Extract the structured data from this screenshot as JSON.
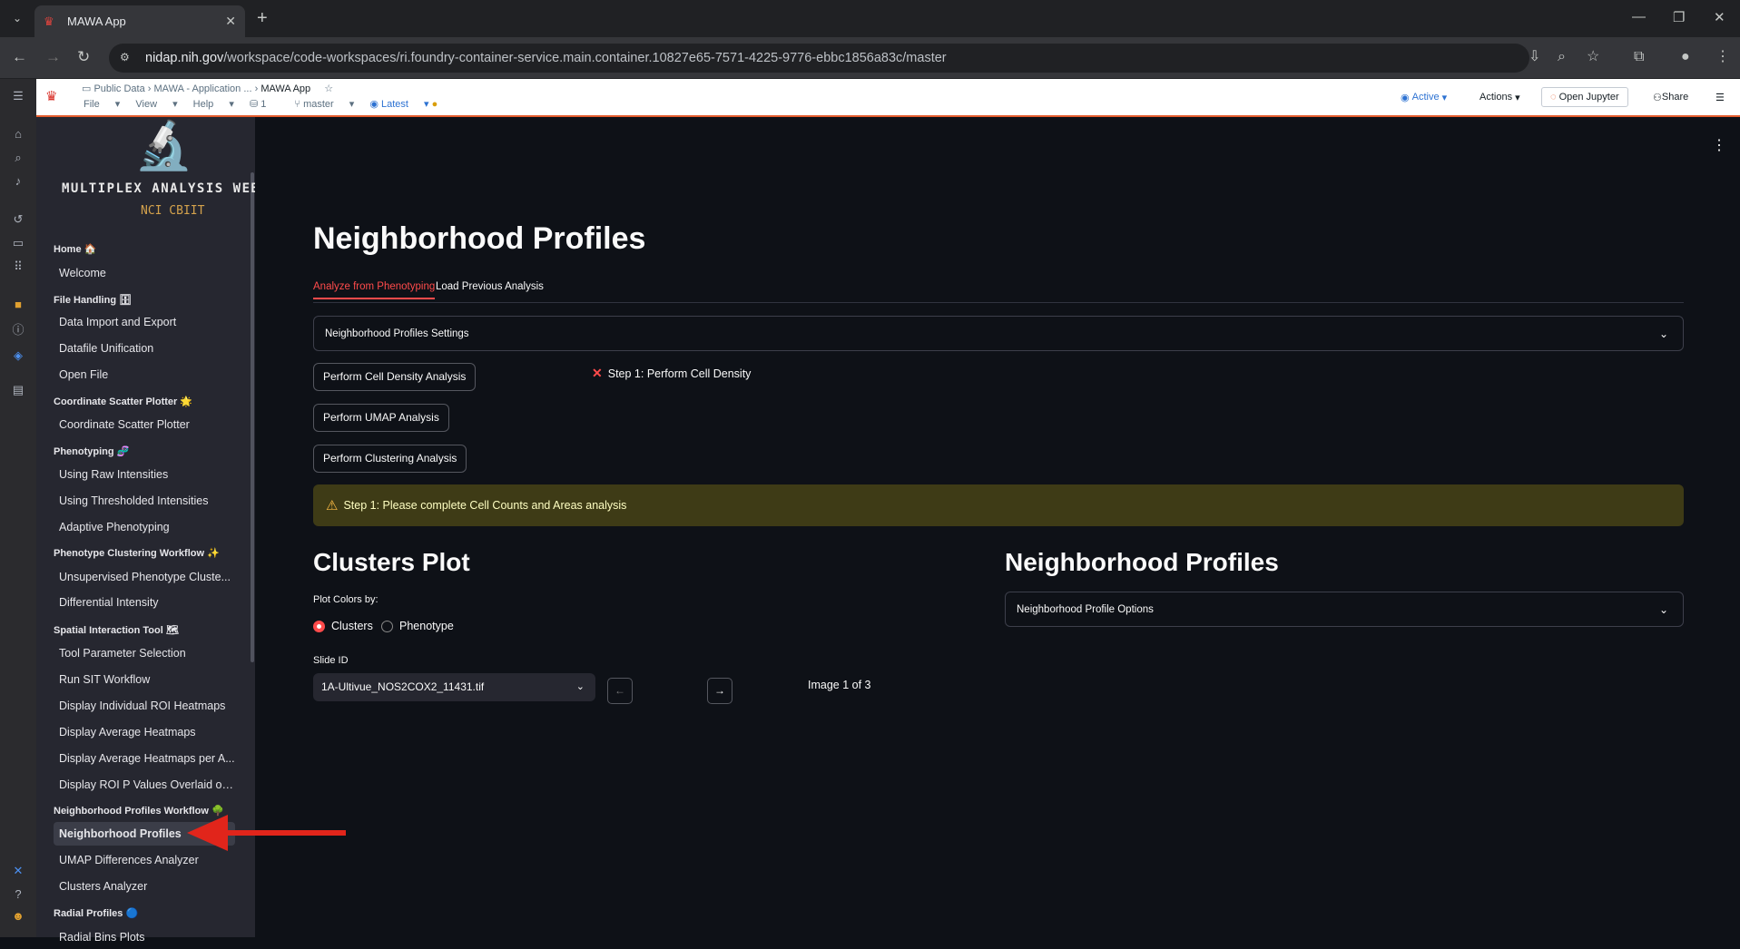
{
  "browser": {
    "tab_title": "MAWA App",
    "url_domain": "nidap.nih.gov",
    "url_path": "/workspace/code-workspaces/ri.foundry-container-service.main.container.10827e65-7571-4225-9776-ebbc1856a83c/master"
  },
  "appbar": {
    "breadcrumb": [
      "Public Data",
      "MAWA - Application ...",
      "MAWA App"
    ],
    "menus": [
      "File",
      "View",
      "Help"
    ],
    "count": "1",
    "branch": "master",
    "version": "Latest",
    "status": "Active",
    "actions_label": "Actions",
    "open_jupyter_label": "Open Jupyter",
    "share_label": "Share"
  },
  "sidebar": {
    "logo_title": "MULTIPLEX ANALYSIS WEB AP",
    "logo_subtitle": "NCI CBIIT",
    "groups": [
      {
        "label": "Home 🏠",
        "items": [
          "Welcome"
        ]
      },
      {
        "label": "File Handling 🗄",
        "items": [
          "Data Import and Export",
          "Datafile Unification",
          "Open File"
        ]
      },
      {
        "label": "Coordinate Scatter Plotter 🌟",
        "items": [
          "Coordinate Scatter Plotter"
        ]
      },
      {
        "label": "Phenotyping 🧬",
        "items": [
          "Using Raw Intensities",
          "Using Thresholded Intensities",
          "Adaptive Phenotyping"
        ]
      },
      {
        "label": "Phenotype Clustering Workflow ✨",
        "items": [
          "Unsupervised Phenotype Cluste...",
          "Differential Intensity"
        ]
      },
      {
        "label": "Spatial Interaction Tool 🗺",
        "items": [
          "Tool Parameter Selection",
          "Run SIT Workflow",
          "Display Individual ROI Heatmaps",
          "Display Average Heatmaps",
          "Display Average Heatmaps per A...",
          "Display ROI P Values Overlaid on..."
        ]
      },
      {
        "label": "Neighborhood Profiles Workflow 🌳",
        "items": [
          "Neighborhood Profiles",
          "UMAP Differences Analyzer",
          "Clusters Analyzer"
        ]
      },
      {
        "label": "Radial Profiles 🔵",
        "items": [
          "Radial Bins Plots"
        ]
      }
    ],
    "selected": "Neighborhood Profiles"
  },
  "main": {
    "title": "Neighborhood Profiles",
    "tabs": [
      "Analyze from Phenotyping",
      "Load Previous Analysis"
    ],
    "settings_expander": "Neighborhood Profiles Settings",
    "buttons": [
      "Perform Cell Density Analysis",
      "Perform UMAP Analysis",
      "Perform Clustering Analysis"
    ],
    "step_status": "Step 1: Perform Cell Density",
    "warning": "Step 1: Please complete Cell Counts and Areas analysis",
    "clusters_plot": {
      "title": "Clusters Plot",
      "color_label": "Plot Colors by:",
      "radio_options": [
        "Clusters",
        "Phenotype"
      ],
      "radio_selected": "Clusters",
      "slide_label": "Slide ID",
      "slide_value": "1A-Ultivue_NOS2COX2_11431.tif",
      "image_count": "Image 1 of 3"
    },
    "neighborhood_profiles": {
      "title": "Neighborhood Profiles",
      "options_expander": "Neighborhood Profile Options"
    }
  },
  "colors": {
    "accent": "#ff4b4b",
    "warning_bg": "#3e3b16",
    "sidebar_bg": "#262730",
    "main_bg": "#0e1117"
  }
}
